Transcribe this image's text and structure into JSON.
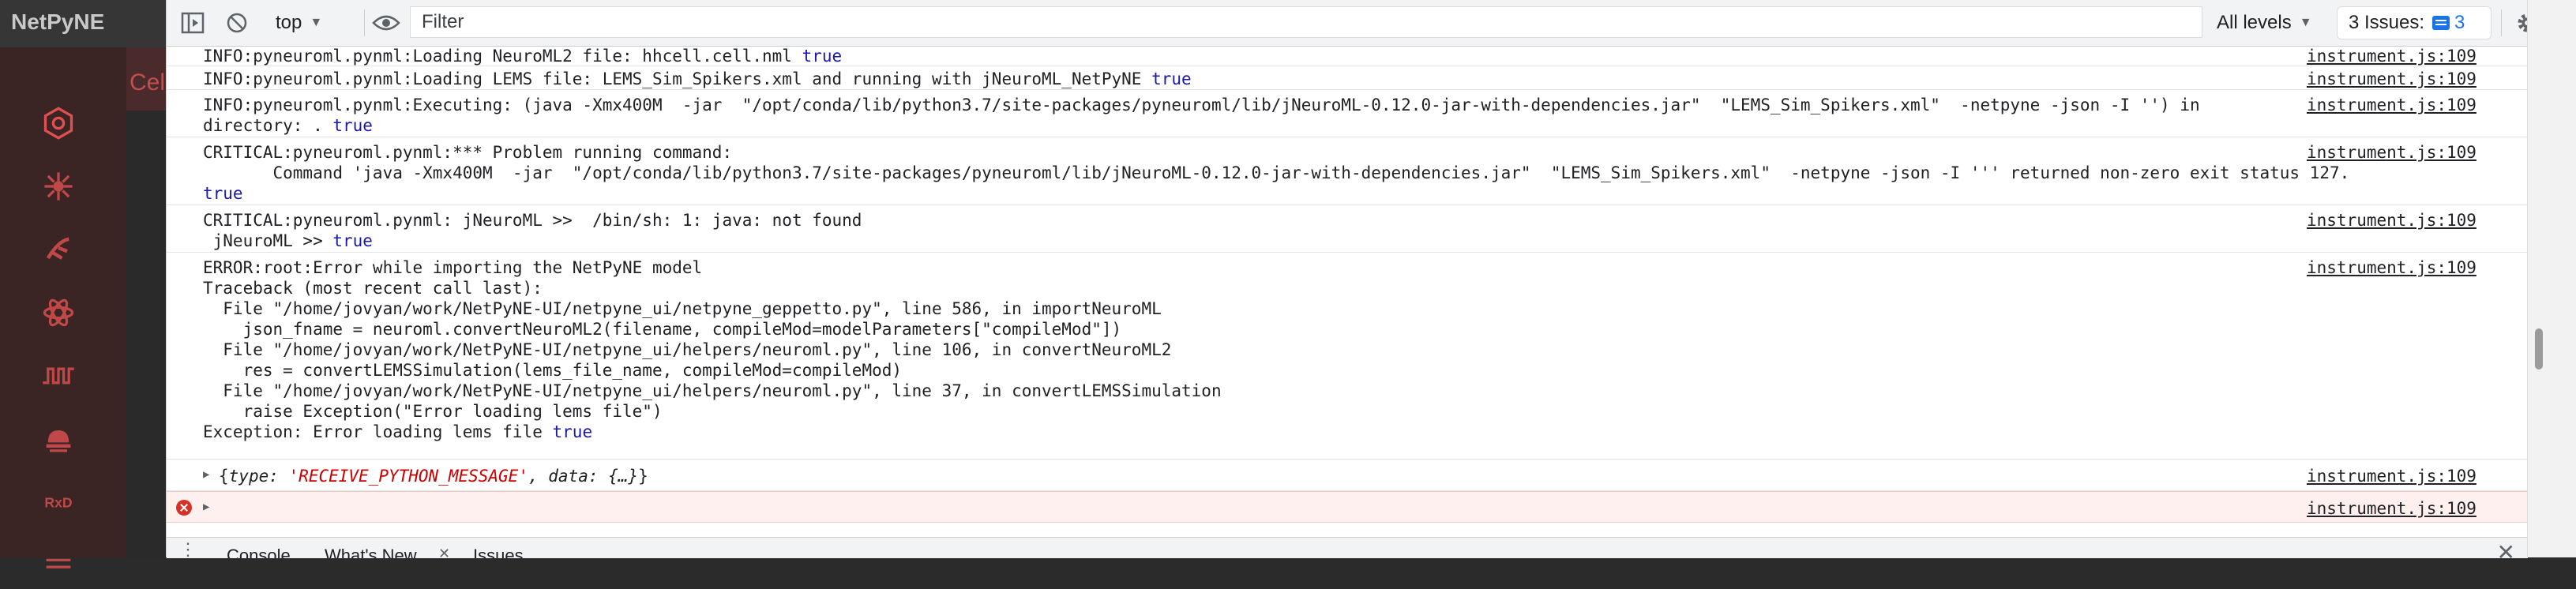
{
  "app": {
    "title": "NetPyNE",
    "content_fragment": "Cell"
  },
  "toolbar": {
    "context": "top",
    "filter_placeholder": "Filter",
    "levels_label": "All levels",
    "issues_label": "3 Issues:",
    "issues_count": "3"
  },
  "log": {
    "source": "instrument.js:109",
    "messages": [
      {
        "pre": "INFO:pyneuroml.pynml:Loading NeuroML2 file: hhcell.cell.nml ",
        "val": "true"
      },
      {
        "pre": "INFO:pyneuroml.pynml:Loading LEMS file: LEMS_Sim_Spikers.xml and running with jNeuroML_NetPyNE ",
        "val": "true"
      },
      {
        "pre": "INFO:pyneuroml.pynml:Executing: (java -Xmx400M  -jar  \"/opt/conda/lib/python3.7/site-packages/pyneuroml/lib/jNeuroML-0.12.0-jar-with-dependencies.jar\"  \"LEMS_Sim_Spikers.xml\"  -netpyne -json -I '') in\ndirectory: . ",
        "val": "true"
      },
      {
        "pre": "CRITICAL:pyneuroml.pynml:*** Problem running command:\n       Command 'java -Xmx400M  -jar  \"/opt/conda/lib/python3.7/site-packages/pyneuroml/lib/jNeuroML-0.12.0-jar-with-dependencies.jar\"  \"LEMS_Sim_Spikers.xml\"  -netpyne -json -I ''' returned non-zero exit status 127.\n",
        "val": "true"
      },
      {
        "pre": "CRITICAL:pyneuroml.pynml: jNeuroML >>  /bin/sh: 1: java: not found\n jNeuroML >> ",
        "val": "true"
      },
      {
        "pre": "ERROR:root:Error while importing the NetPyNE model\nTraceback (most recent call last):\n  File \"/home/jovyan/work/NetPyNE-UI/netpyne_ui/netpyne_geppetto.py\", line 586, in importNeuroML\n    json_fname = neuroml.convertNeuroML2(filename, compileMod=modelParameters[\"compileMod\"])\n  File \"/home/jovyan/work/NetPyNE-UI/netpyne_ui/helpers/neuroml.py\", line 106, in convertNeuroML2\n    res = convertLEMSSimulation(lems_file_name, compileMod=compileMod)\n  File \"/home/jovyan/work/NetPyNE-UI/netpyne_ui/helpers/neuroml.py\", line 37, in convertLEMSSimulation\n    raise Exception(\"Error loading lems file\")\nException: Error loading lems file ",
        "val": "true"
      }
    ],
    "object_message": {
      "open": "{",
      "type_key": "type",
      "type_val": "'RECEIVE_PYTHON_MESSAGE'",
      "data_key": "data",
      "data_val": "{…}",
      "close": "}"
    }
  },
  "drawer": {
    "tabs": [
      "Console",
      "What's New",
      "Issues"
    ]
  }
}
